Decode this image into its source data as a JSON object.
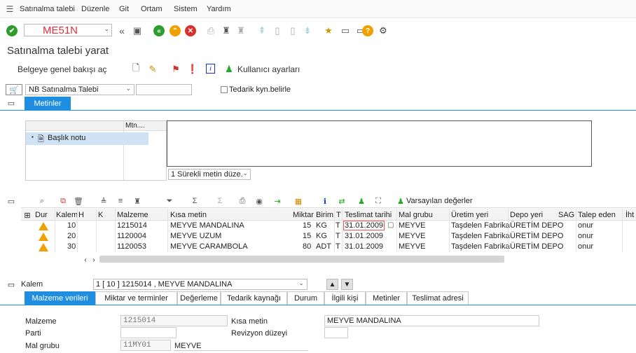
{
  "menu": {
    "items": [
      "Satınalma talebi",
      "Düzenle",
      "Git",
      "Ortam",
      "Sistem",
      "Yardım"
    ]
  },
  "toolbar": {
    "command_value": "ME51N"
  },
  "page": {
    "title": "Satınalma talebi yarat"
  },
  "app_toolbar": {
    "overview_label": "Belgeye genel bakışı aç",
    "user_settings_label": "Kullanıcı ayarları"
  },
  "header": {
    "doc_type": "NB Satınalma Talebi",
    "vendor_checkbox_label": "Tedarik kyn.belirle"
  },
  "text_section": {
    "tab_label": "Metinler",
    "col_header": "Mtn....",
    "item_label": "Başlık notu",
    "mode_select": "1 Sürekli metin düze."
  },
  "items_toolbar": {
    "default_values_label": "Varsayılan değerler"
  },
  "grid": {
    "columns": [
      "Dur",
      "Kalem",
      "H",
      "K",
      "Malzeme",
      "Kısa metin",
      "Miktar",
      "Birim",
      "T",
      "Teslimat tarihi",
      "Mal grubu",
      "Üretim yeri",
      "Depo yeri",
      "SAG",
      "Talep eden",
      "İht"
    ],
    "rows": [
      {
        "kalem": "10",
        "malzeme": "1215014",
        "kisa_metin": "MEYVE MANDALINA",
        "miktar": "15",
        "birim": "KG",
        "t": "T",
        "tarih": "31.01.2009",
        "mal_grubu": "MEYVE",
        "uretim_yeri": "Taşdelen Fabrika",
        "depo_yeri": "ÜRETİM DEPO",
        "talep_eden": "onur"
      },
      {
        "kalem": "20",
        "malzeme": "1120004",
        "kisa_metin": "MEYVE UZUM",
        "miktar": "15",
        "birim": "KG",
        "t": "T",
        "tarih": "31.01.2009",
        "mal_grubu": "MEYVE",
        "uretim_yeri": "Taşdelen Fabrika",
        "depo_yeri": "ÜRETİM DEPO",
        "talep_eden": "onur"
      },
      {
        "kalem": "30",
        "malzeme": "1120053",
        "kisa_metin": "MEYVE CARAMBOLA",
        "miktar": "80",
        "birim": "ADT",
        "t": "T",
        "tarih": "31.01.2009",
        "mal_grubu": "MEYVE",
        "uretim_yeri": "Taşdelen Fabrika",
        "depo_yeri": "ÜRETİM DEPO",
        "talep_eden": "onur"
      }
    ]
  },
  "detail": {
    "item_label": "Kalem",
    "item_select": "1 [ 10 ] 1215014 , MEYVE MANDALINA",
    "tabs": [
      "Malzeme verileri",
      "Miktar ve terminler",
      "Değerleme",
      "Tedarik kaynağı",
      "Durum",
      "İlgili kişi",
      "Metinler",
      "Teslimat adresi"
    ],
    "malzeme_label": "Malzeme",
    "malzeme_value": "1215014",
    "parti_label": "Parti",
    "mal_grubu_label": "Mal grubu",
    "mal_grubu_code": "11MY01",
    "mal_grubu_text": "MEYVE",
    "kisa_metin_label": "Kısa metin",
    "kisa_metin_value": "MEYVE MANDALINA",
    "revizyon_label": "Revizyon düzeyi"
  },
  "colors": {
    "accent": "#1f8ee0",
    "warning": "#f0a000",
    "ok": "#2e9d2e",
    "stop": "#d9302c",
    "command": "#e0303c"
  }
}
